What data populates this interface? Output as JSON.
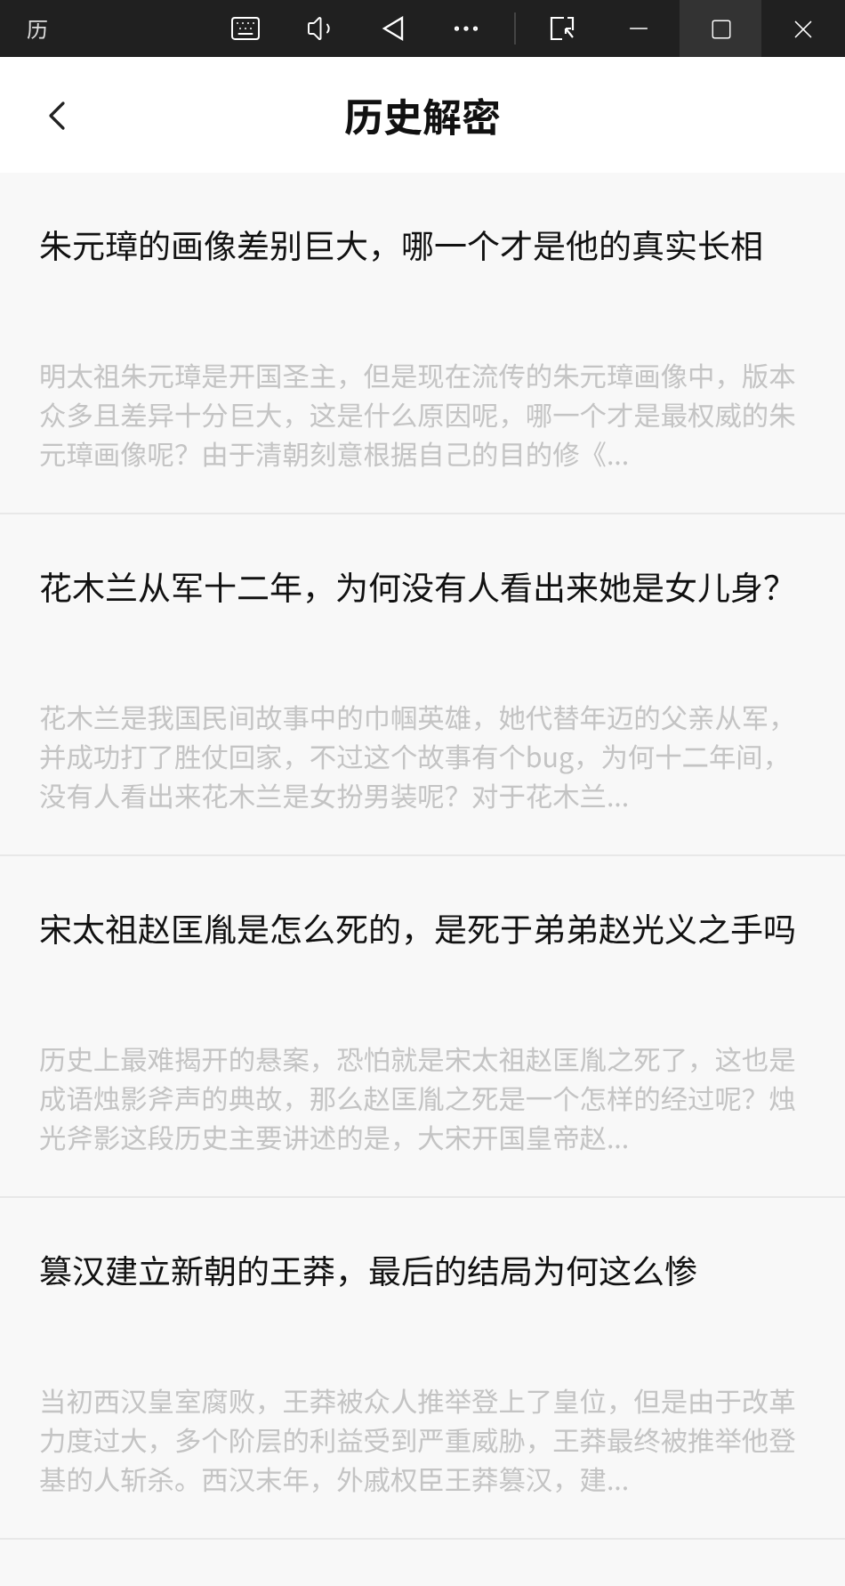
{
  "title_bar": {
    "title": "历"
  },
  "header": {
    "title": "历史解密"
  },
  "articles": [
    {
      "title": "朱元璋的画像差别巨大，哪一个才是他的真实长相",
      "summary": "明太祖朱元璋是开国圣主，但是现在流传的朱元璋画像中，版本众多且差异十分巨大，这是什么原因呢，哪一个才是最权威的朱元璋画像呢？由于清朝刻意根据自己的目的修《..."
    },
    {
      "title": "花木兰从军十二年，为何没有人看出来她是女儿身？",
      "summary": "花木兰是我国民间故事中的巾帼英雄，她代替年迈的父亲从军，并成功打了胜仗回家，不过这个故事有个bug，为何十二年间，没有人看出来花木兰是女扮男装呢？对于花木兰..."
    },
    {
      "title": "宋太祖赵匡胤是怎么死的，是死于弟弟赵光义之手吗",
      "summary": "历史上最难揭开的悬案，恐怕就是宋太祖赵匡胤之死了，这也是成语烛影斧声的典故，那么赵匡胤之死是一个怎样的经过呢？烛光斧影这段历史主要讲述的是，大宋开国皇帝赵..."
    },
    {
      "title": "篡汉建立新朝的王莽，最后的结局为何这么惨",
      "summary": "当初西汉皇室腐败，王莽被众人推举登上了皇位，但是由于改革力度过大，多个阶层的利益受到严重威胁，王莽最终被推举他登基的人斩杀。西汉末年，外戚权臣王莽篡汉，建..."
    }
  ]
}
